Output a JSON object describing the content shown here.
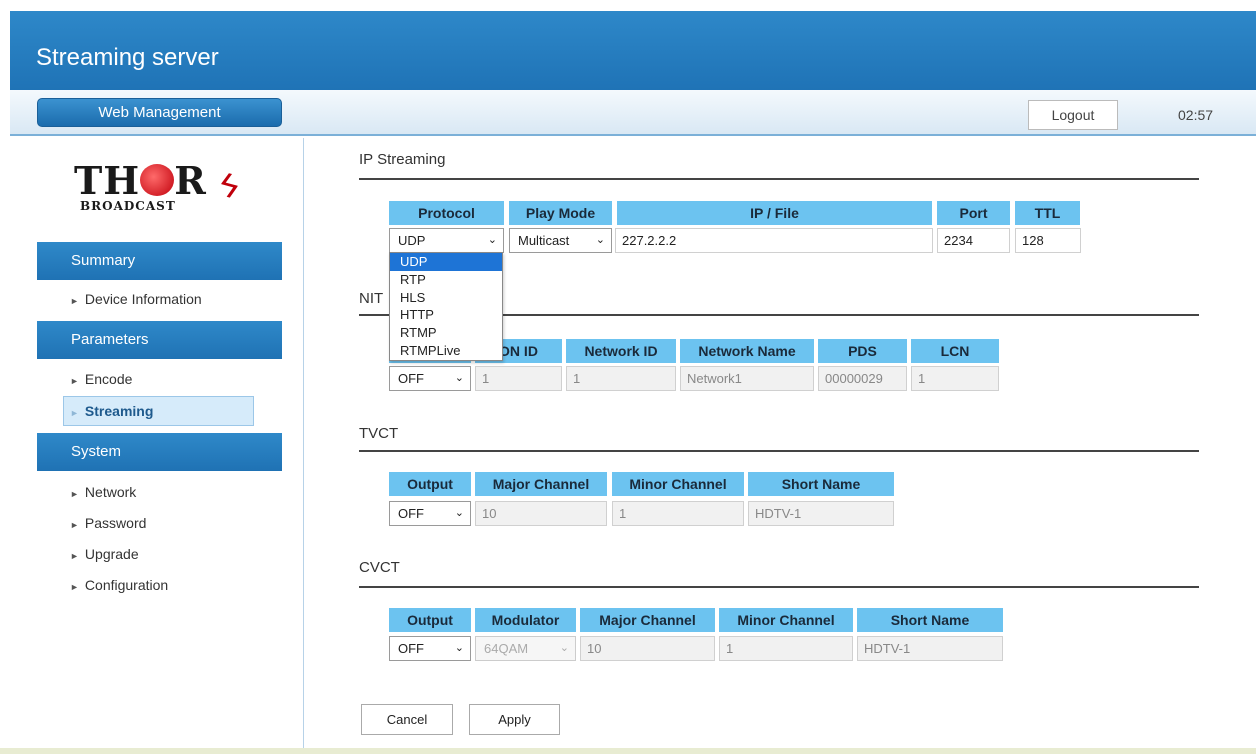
{
  "header": {
    "title": "Streaming server"
  },
  "subbar": {
    "web_management": "Web Management",
    "logout": "Logout",
    "time": "02:57"
  },
  "logo": {
    "word_left": "TH",
    "word_right": "R",
    "sub": "BROADCAST"
  },
  "sidebar": {
    "summary": "Summary",
    "device_information": "Device Information",
    "parameters": "Parameters",
    "encode": "Encode",
    "streaming": "Streaming",
    "system": "System",
    "network": "Network",
    "password": "Password",
    "upgrade": "Upgrade",
    "configuration": "Configuration"
  },
  "ip_streaming": {
    "title": "IP Streaming",
    "headers": {
      "protocol": "Protocol",
      "play_mode": "Play Mode",
      "ip_file": "IP / File",
      "port": "Port",
      "ttl": "TTL"
    },
    "protocol": "UDP",
    "play_mode": "Multicast",
    "ip_file": "227.2.2.2",
    "port": "2234",
    "ttl": "128",
    "protocol_options": [
      "UDP",
      "RTP",
      "HLS",
      "HTTP",
      "RTMP",
      "RTMPLive"
    ]
  },
  "nit": {
    "title": "NIT",
    "headers": {
      "on_id": "ON ID",
      "network_id": "Network ID",
      "network_name": "Network Name",
      "pds": "PDS",
      "lcn": "LCN"
    },
    "output": "OFF",
    "on_id": "1",
    "network_id": "1",
    "network_name": "Network1",
    "pds": "00000029",
    "lcn": "1"
  },
  "tvct": {
    "title": "TVCT",
    "headers": {
      "output": "Output",
      "major_channel": "Major Channel",
      "minor_channel": "Minor Channel",
      "short_name": "Short Name"
    },
    "output": "OFF",
    "major_channel": "10",
    "minor_channel": "1",
    "short_name": "HDTV-1"
  },
  "cvct": {
    "title": "CVCT",
    "headers": {
      "output": "Output",
      "modulator": "Modulator",
      "major_channel": "Major Channel",
      "minor_channel": "Minor Channel",
      "short_name": "Short Name"
    },
    "output": "OFF",
    "modulator": "64QAM",
    "major_channel": "10",
    "minor_channel": "1",
    "short_name": "HDTV-1"
  },
  "actions": {
    "cancel": "Cancel",
    "apply": "Apply"
  }
}
